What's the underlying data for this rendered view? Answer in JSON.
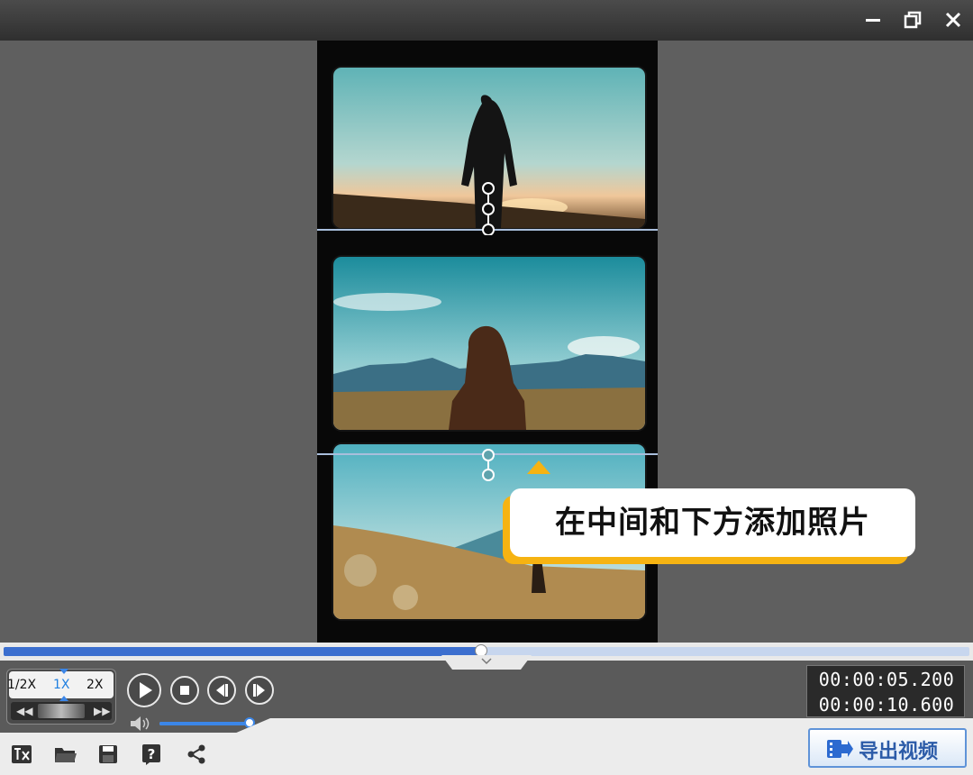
{
  "overlay": {
    "tip_text": "在中间和下方添加照片"
  },
  "playback": {
    "speeds": [
      "1/2X",
      "1X",
      "2X"
    ],
    "active_speed": "1X",
    "current_time": "00:00:05.200",
    "total_time": "00:00:10.600",
    "progress": 0.494,
    "volume": 0.98
  },
  "toolbar": {
    "export_label": "导出视频"
  },
  "icons": {
    "window": [
      "minimize-icon",
      "restore-icon",
      "close-icon"
    ],
    "transport": [
      "play-icon",
      "stop-icon",
      "previous-frame-icon",
      "next-frame-icon",
      "rewind-icon",
      "fast-forward-icon",
      "speaker-icon"
    ],
    "tools": [
      "text-tool-icon",
      "open-folder-icon",
      "save-icon",
      "help-icon",
      "share-icon",
      "export-video-icon"
    ]
  },
  "colors": {
    "accent": "#3c6fcf",
    "tip_border": "#f6b312",
    "export_border": "#5f93d8"
  }
}
